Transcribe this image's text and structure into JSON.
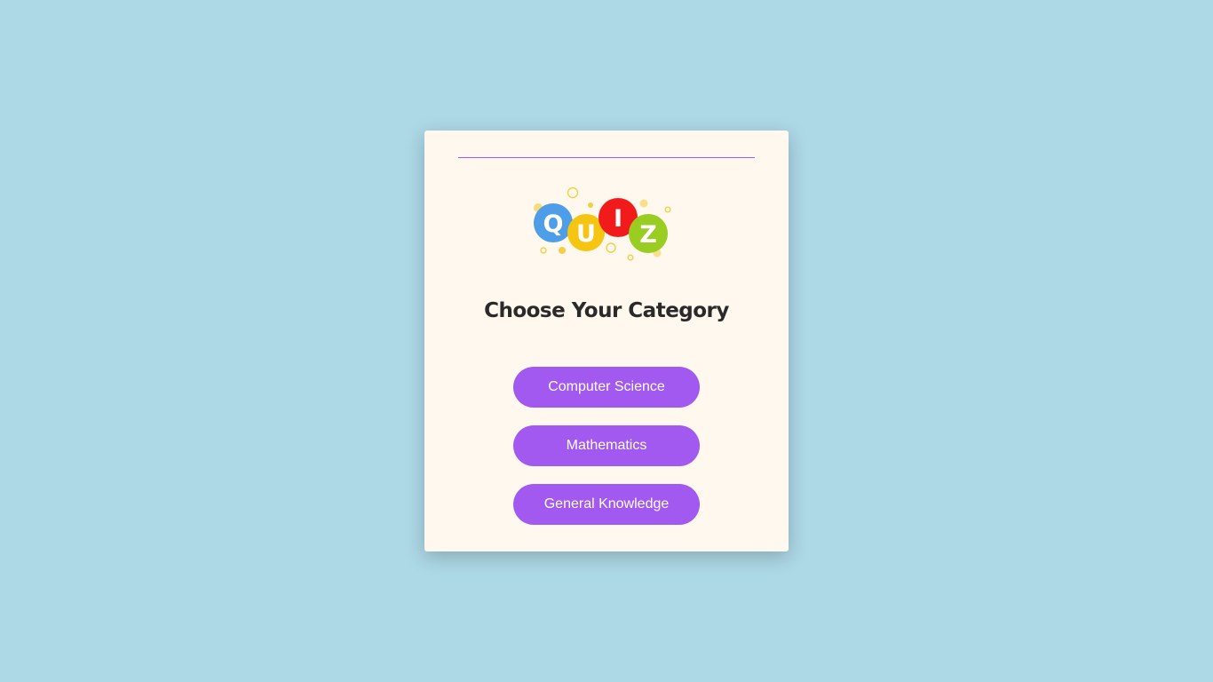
{
  "logo": {
    "letters": [
      "Q",
      "U",
      "I",
      "Z"
    ],
    "colors": {
      "q": "#4d9de8",
      "u": "#f6c511",
      "i": "#f21b1b",
      "z": "#9acd22",
      "confetti": "#f3cf47"
    }
  },
  "heading": "Choose Your Category",
  "categories": [
    {
      "label": "Computer Science"
    },
    {
      "label": "Mathematics"
    },
    {
      "label": "General Knowledge"
    }
  ],
  "colors": {
    "background": "#add8e6",
    "card": "#fff8ee",
    "accent": "#a259ef",
    "heading": "#2a2a2a"
  }
}
